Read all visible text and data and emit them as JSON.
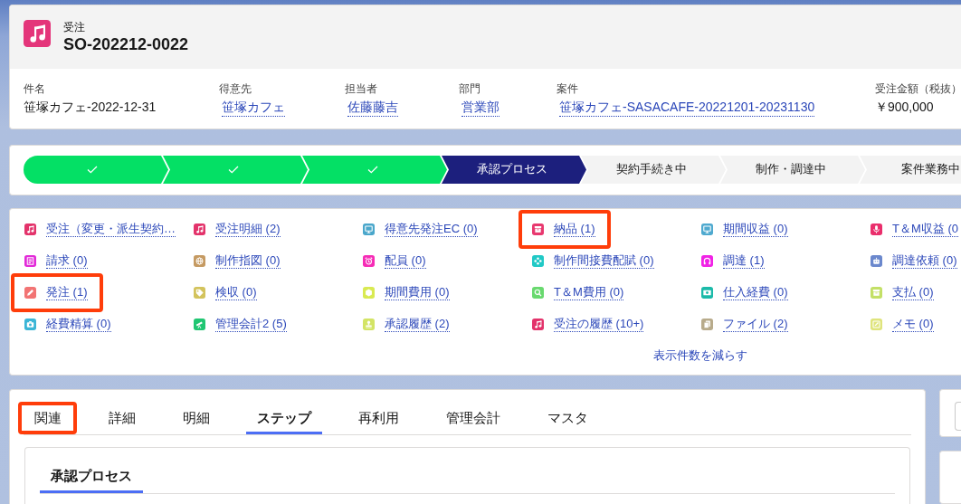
{
  "record_header": {
    "object_label": "受注",
    "title": "SO-202212-0022"
  },
  "highlights": [
    {
      "label": "件名",
      "value": "笹塚カフェ-2022-12-31",
      "kind": "text"
    },
    {
      "label": "得意先",
      "value": "笹塚カフェ",
      "kind": "link"
    },
    {
      "label": "担当者",
      "value": "佐藤藤吉",
      "kind": "link"
    },
    {
      "label": "部門",
      "value": "営業部",
      "kind": "link"
    },
    {
      "label": "案件",
      "value": "笹塚カフェ-SASACAFE-20221201-20231130",
      "kind": "link"
    },
    {
      "label": "受注金額（税抜）",
      "value": "￥900,000",
      "kind": "text"
    }
  ],
  "path": [
    {
      "completed": true,
      "selected": false
    },
    {
      "completed": true,
      "selected": false
    },
    {
      "completed": true,
      "selected": false
    },
    {
      "label": "承認プロセス",
      "completed": false,
      "selected": true
    },
    {
      "label": "契約手続き中",
      "completed": false,
      "selected": false
    },
    {
      "label": "制作・調達中",
      "completed": false,
      "selected": false
    },
    {
      "label": "案件業務中",
      "completed": false,
      "selected": false
    }
  ],
  "related_links": {
    "items": [
      {
        "label": "受注（変更・派生契約…",
        "color": "#e3336b",
        "highlighted": false
      },
      {
        "label": "受注明細 (2)",
        "color": "#e3336b",
        "highlighted": false
      },
      {
        "label": "得意先発注EC (0)",
        "color": "#4aa7cb",
        "highlighted": false
      },
      {
        "label": "納品 (1)",
        "color": "#e8386f",
        "highlighted": true
      },
      {
        "label": "期間収益 (0)",
        "color": "#4ea9cf",
        "highlighted": false
      },
      {
        "label": "T＆M収益 (0",
        "color": "#ea2e6c",
        "highlighted": false
      },
      {
        "label": "請求 (0)",
        "color": "#e22ad8",
        "highlighted": false
      },
      {
        "label": "制作指図 (0)",
        "color": "#c59a62",
        "highlighted": false
      },
      {
        "label": "配員 (0)",
        "color": "#f62cb6",
        "highlighted": false
      },
      {
        "label": "制作間接費配賦 (0)",
        "color": "#21c9c6",
        "highlighted": false
      },
      {
        "label": "調達 (1)",
        "color": "#f122e6",
        "highlighted": false
      },
      {
        "label": "調達依頼 (0)",
        "color": "#6b88cd",
        "highlighted": false
      },
      {
        "label": "発注 (1)",
        "color": "#f27474",
        "highlighted": true
      },
      {
        "label": "検収 (0)",
        "color": "#d3c35c",
        "highlighted": false
      },
      {
        "label": "期間費用 (0)",
        "color": "#d9ea52",
        "highlighted": false
      },
      {
        "label": "T＆M費用 (0)",
        "color": "#69d96f",
        "highlighted": false
      },
      {
        "label": "仕入経費 (0)",
        "color": "#1bbaa9",
        "highlighted": false
      },
      {
        "label": "支払 (0)",
        "color": "#c3e066",
        "highlighted": false
      },
      {
        "label": "経費精算 (0)",
        "color": "#3bb5d6",
        "highlighted": false
      },
      {
        "label": "管理会計2 (5)",
        "color": "#20c672",
        "highlighted": false
      },
      {
        "label": "承認履歴 (2)",
        "color": "#d3e465",
        "highlighted": false
      },
      {
        "label": "受注の履歴 (10+)",
        "color": "#e3336b",
        "highlighted": false
      },
      {
        "label": "ファイル (2)",
        "color": "#b8ab8b",
        "highlighted": false
      },
      {
        "label": "メモ (0)",
        "color": "#dfe47c",
        "highlighted": false
      }
    ],
    "show_less": "表示件数を減らす"
  },
  "record_tabs": [
    {
      "label": "関連",
      "selected": false,
      "highlighted": true
    },
    {
      "label": "詳細",
      "selected": false,
      "highlighted": false
    },
    {
      "label": "明細",
      "selected": false,
      "highlighted": false
    },
    {
      "label": "ステップ",
      "selected": true,
      "highlighted": false
    },
    {
      "label": "再利用",
      "selected": false,
      "highlighted": false
    },
    {
      "label": "管理会計",
      "selected": false,
      "highlighted": false
    },
    {
      "label": "マスタ",
      "selected": false,
      "highlighted": false
    }
  ],
  "step_panel": {
    "tabs": [
      {
        "label": "承認プロセス",
        "selected": true
      }
    ]
  }
}
